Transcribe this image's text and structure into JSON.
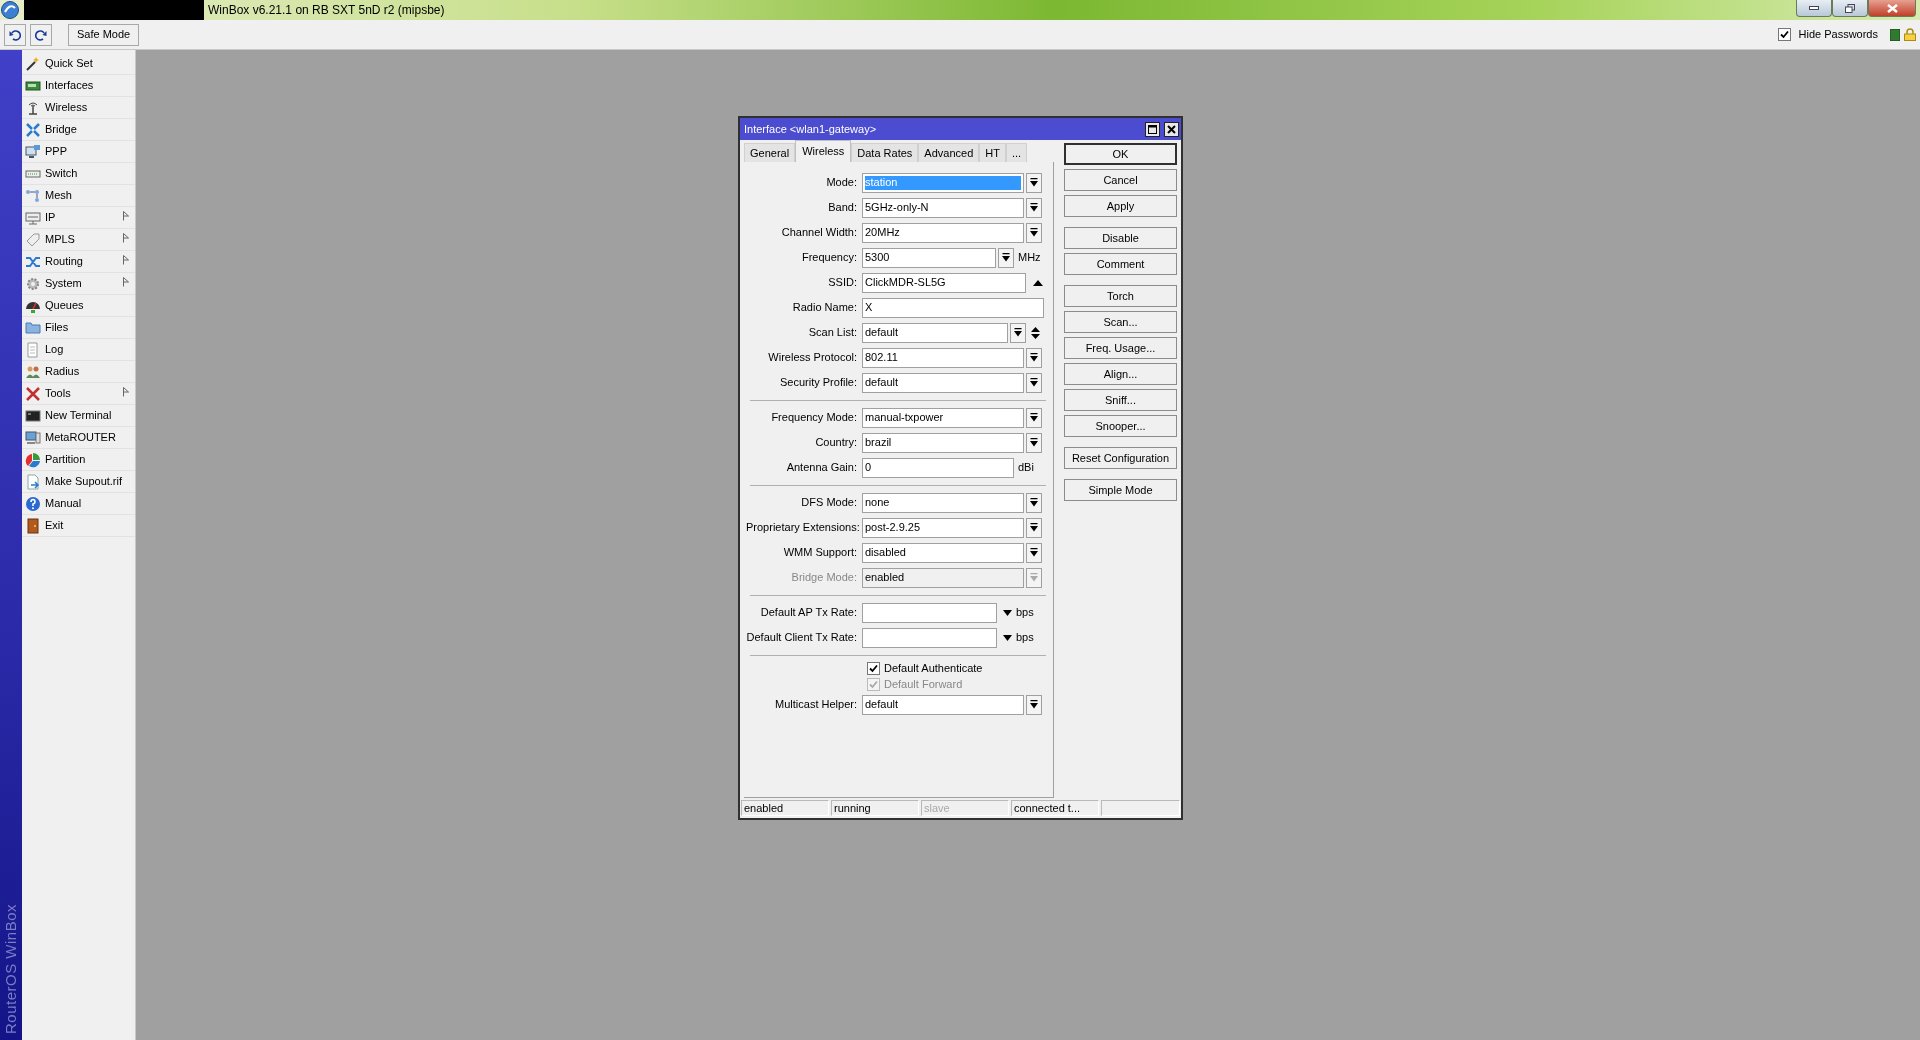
{
  "titlebar": {
    "title": "WinBox v6.21.1 on RB SXT 5nD r2 (mipsbe)"
  },
  "toolbar": {
    "safe_mode": "Safe Mode",
    "hide_passwords": {
      "label": "Hide Passwords",
      "checked": true
    }
  },
  "sidebar": {
    "brand": "RouterOS WinBox",
    "items": [
      {
        "label": "Quick Set",
        "submenu": false
      },
      {
        "label": "Interfaces",
        "submenu": false
      },
      {
        "label": "Wireless",
        "submenu": false
      },
      {
        "label": "Bridge",
        "submenu": false
      },
      {
        "label": "PPP",
        "submenu": false
      },
      {
        "label": "Switch",
        "submenu": false
      },
      {
        "label": "Mesh",
        "submenu": false
      },
      {
        "label": "IP",
        "submenu": true
      },
      {
        "label": "MPLS",
        "submenu": true
      },
      {
        "label": "Routing",
        "submenu": true
      },
      {
        "label": "System",
        "submenu": true
      },
      {
        "label": "Queues",
        "submenu": false
      },
      {
        "label": "Files",
        "submenu": false
      },
      {
        "label": "Log",
        "submenu": false
      },
      {
        "label": "Radius",
        "submenu": false
      },
      {
        "label": "Tools",
        "submenu": true
      },
      {
        "label": "New Terminal",
        "submenu": false
      },
      {
        "label": "MetaROUTER",
        "submenu": false
      },
      {
        "label": "Partition",
        "submenu": false
      },
      {
        "label": "Make Supout.rif",
        "submenu": false
      },
      {
        "label": "Manual",
        "submenu": false
      },
      {
        "label": "Exit",
        "submenu": false
      }
    ]
  },
  "dialog": {
    "title": "Interface <wlan1-gateway>",
    "tabs": [
      {
        "label": "General",
        "selected": false
      },
      {
        "label": "Wireless",
        "selected": true
      },
      {
        "label": "Data Rates",
        "selected": false
      },
      {
        "label": "Advanced",
        "selected": false
      },
      {
        "label": "HT",
        "selected": false
      },
      {
        "label": "...",
        "selected": false
      }
    ],
    "form": [
      {
        "kind": "select",
        "label": "Mode:",
        "value": "station",
        "focused": true,
        "disabled": false
      },
      {
        "kind": "select",
        "label": "Band:",
        "value": "5GHz-only-N",
        "focused": false,
        "disabled": false
      },
      {
        "kind": "select",
        "label": "Channel Width:",
        "value": "20MHz",
        "focused": false,
        "disabled": false
      },
      {
        "kind": "combo",
        "label": "Frequency:",
        "value": "5300",
        "unit": "MHz",
        "focused": false,
        "disabled": false
      },
      {
        "kind": "text_collapse",
        "label": "SSID:",
        "value": "ClickMDR-SL5G",
        "focused": false,
        "disabled": false
      },
      {
        "kind": "text",
        "label": "Radio Name:",
        "value": "X",
        "focused": false,
        "disabled": false
      },
      {
        "kind": "combo_updown",
        "label": "Scan List:",
        "value": "default",
        "focused": false,
        "disabled": false
      },
      {
        "kind": "select",
        "label": "Wireless Protocol:",
        "value": "802.11",
        "focused": false,
        "disabled": false
      },
      {
        "kind": "select",
        "label": "Security Profile:",
        "value": "default",
        "focused": false,
        "disabled": false
      },
      {
        "kind": "separator"
      },
      {
        "kind": "select",
        "label": "Frequency Mode:",
        "value": "manual-txpower",
        "focused": false,
        "disabled": false
      },
      {
        "kind": "select",
        "label": "Country:",
        "value": "brazil",
        "focused": false,
        "disabled": false
      },
      {
        "kind": "text",
        "label": "Antenna Gain:",
        "value": "0",
        "unit": "dBi",
        "focused": false,
        "disabled": false
      },
      {
        "kind": "separator"
      },
      {
        "kind": "select",
        "label": "DFS Mode:",
        "value": "none",
        "focused": false,
        "disabled": false
      },
      {
        "kind": "select",
        "label": "Proprietary Extensions:",
        "value": "post-2.9.25",
        "focused": false,
        "disabled": false
      },
      {
        "kind": "select",
        "label": "WMM Support:",
        "value": "disabled",
        "focused": false,
        "disabled": false
      },
      {
        "kind": "select",
        "label": "Bridge Mode:",
        "value": "enabled",
        "focused": false,
        "disabled": true
      },
      {
        "kind": "separator"
      },
      {
        "kind": "rate",
        "label": "Default AP Tx Rate:",
        "unit": "bps",
        "focused": false,
        "disabled": false
      },
      {
        "kind": "rate",
        "label": "Default Client Tx Rate:",
        "unit": "bps",
        "focused": false,
        "disabled": false
      },
      {
        "kind": "separator"
      },
      {
        "kind": "checkbox",
        "label": "Default Authenticate",
        "checked": true,
        "disabled": false
      },
      {
        "kind": "checkbox",
        "label": "Default Forward",
        "checked": true,
        "disabled": true
      },
      {
        "kind": "select",
        "label": "Multicast Helper:",
        "value": "default",
        "focused": false,
        "disabled": false
      }
    ],
    "button_groups": [
      [
        {
          "label": "OK",
          "default": true
        },
        {
          "label": "Cancel",
          "default": false
        },
        {
          "label": "Apply",
          "default": false
        }
      ],
      [
        {
          "label": "Disable",
          "default": false
        },
        {
          "label": "Comment",
          "default": false
        }
      ],
      [
        {
          "label": "Torch",
          "default": false
        },
        {
          "label": "Scan...",
          "default": false
        },
        {
          "label": "Freq. Usage...",
          "default": false
        },
        {
          "label": "Align...",
          "default": false
        },
        {
          "label": "Sniff...",
          "default": false
        },
        {
          "label": "Snooper...",
          "default": false
        }
      ],
      [
        {
          "label": "Reset Configuration",
          "default": false
        }
      ],
      [
        {
          "label": "Simple Mode",
          "default": false
        }
      ]
    ],
    "status_bar": [
      {
        "text": "enabled",
        "disabled": false
      },
      {
        "text": "running",
        "disabled": false
      },
      {
        "text": "slave",
        "disabled": true
      },
      {
        "text": "connected t...",
        "disabled": false
      }
    ]
  }
}
